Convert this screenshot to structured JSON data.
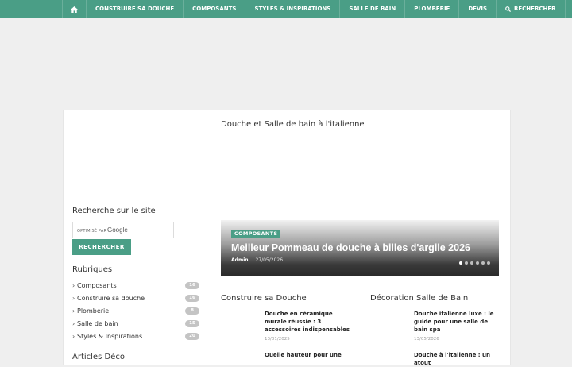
{
  "nav": {
    "items": [
      "CONSTRUIRE SA DOUCHE",
      "COMPOSANTS",
      "STYLES & INSPIRATIONS",
      "SALLE DE BAIN",
      "PLOMBERIE",
      "DEVIS"
    ],
    "search_label": "RECHERCHER"
  },
  "site_title": "Douche et Salle de bain à l'italienne",
  "sidebar": {
    "search_heading": "Recherche sur le site",
    "google_optimized": "OPTIMISÉ PAR",
    "google_brand": "Google",
    "search_button": "RECHERCHER",
    "rubriques_heading": "Rubriques",
    "categories": [
      {
        "label": "Composants",
        "count": "16"
      },
      {
        "label": "Construire sa douche",
        "count": "16"
      },
      {
        "label": "Plomberie",
        "count": "8"
      },
      {
        "label": "Salle de bain",
        "count": "15"
      },
      {
        "label": "Styles & Inspirations",
        "count": "20"
      }
    ],
    "deco_heading": "Articles Déco"
  },
  "slider": {
    "tag": "COMPOSANTS",
    "title": "Meilleur Pommeau de douche à billes d'argile 2026",
    "author": "Admin",
    "date": "27/05/2026"
  },
  "col1": {
    "heading": "Construire sa Douche",
    "articles": [
      {
        "title": "Douche en céramique murale réussie : 3 accessoires indispensables",
        "date": "13/01/2025"
      },
      {
        "title": "Quelle hauteur pour une"
      }
    ]
  },
  "col2": {
    "heading": "Décoration Salle de Bain",
    "articles": [
      {
        "title": "Douche italienne luxe : le guide pour une salle de bain spa",
        "date": "13/05/2026"
      },
      {
        "title": "Douche à l'italienne : un atout"
      }
    ]
  },
  "colors": {
    "accent": "#4a9e86",
    "badge": "#c4c4c4"
  }
}
